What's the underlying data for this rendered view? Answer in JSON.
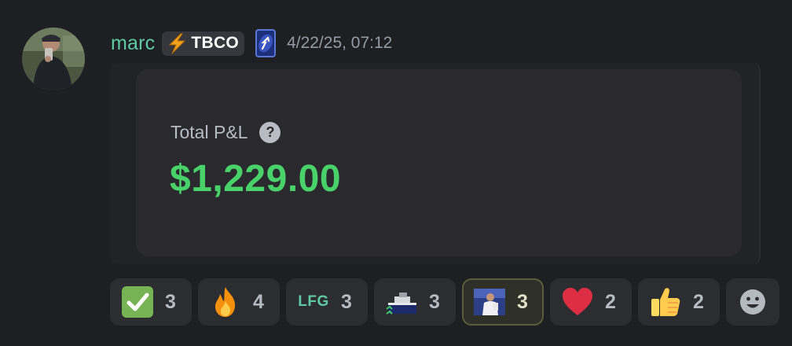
{
  "message": {
    "author": {
      "username": "marc",
      "tag": {
        "icon": "lightning-icon",
        "text": "TBCO"
      },
      "role_icon": "reverse-card-icon",
      "avatar": "avatar-image"
    },
    "timestamp": "4/22/25, 07:12",
    "attachment": {
      "label": "Total P&L",
      "help_icon": "question-icon",
      "help_glyph": "?",
      "value": "$1,229.00",
      "value_color": "#49d16a"
    },
    "reactions": [
      {
        "emoji": "check-mark-icon",
        "count": "3",
        "active": false
      },
      {
        "emoji": "fire-icon",
        "count": "4",
        "active": false
      },
      {
        "emoji": "lfg-icon",
        "label": "LFG",
        "count": "3",
        "active": false
      },
      {
        "emoji": "boat-icon",
        "count": "3",
        "active": false
      },
      {
        "emoji": "player-photo-icon",
        "count": "3",
        "active": true
      },
      {
        "emoji": "heart-icon",
        "count": "2",
        "active": false
      },
      {
        "emoji": "thumbs-up-icon",
        "count": "2",
        "active": false
      }
    ],
    "add_reaction_icon": "smiley-icon"
  },
  "colors": {
    "username": "#5fc9a4",
    "background": "#1e1f22",
    "accent_green": "#49d16a"
  }
}
